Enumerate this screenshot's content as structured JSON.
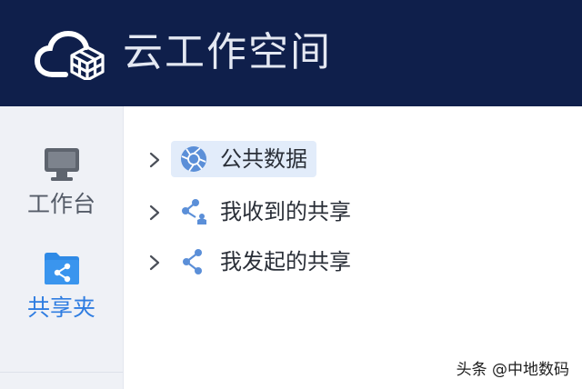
{
  "header": {
    "app_title": "云工作空间",
    "logo_icon": "cloud-cube-logo-icon",
    "background_color": "#0f1f4b"
  },
  "sidebar": {
    "items": [
      {
        "label": "工作台",
        "icon": "monitor-icon",
        "active": false
      },
      {
        "label": "共享夹",
        "icon": "shared-folder-icon",
        "active": true
      }
    ],
    "active_color": "#2f7de1"
  },
  "tree": {
    "nodes": [
      {
        "label": "公共数据",
        "icon": "aperture-icon",
        "selected": true,
        "expand_icon": "chevron-right-icon"
      },
      {
        "label": "我收到的共享",
        "icon": "share-received-icon",
        "selected": false,
        "expand_icon": "chevron-right-icon"
      },
      {
        "label": "我发起的共享",
        "icon": "share-icon",
        "selected": false,
        "expand_icon": "chevron-right-icon"
      }
    ],
    "selected_bg": "#e2ecfa"
  },
  "watermark": {
    "text": "头条 @中地数码"
  }
}
